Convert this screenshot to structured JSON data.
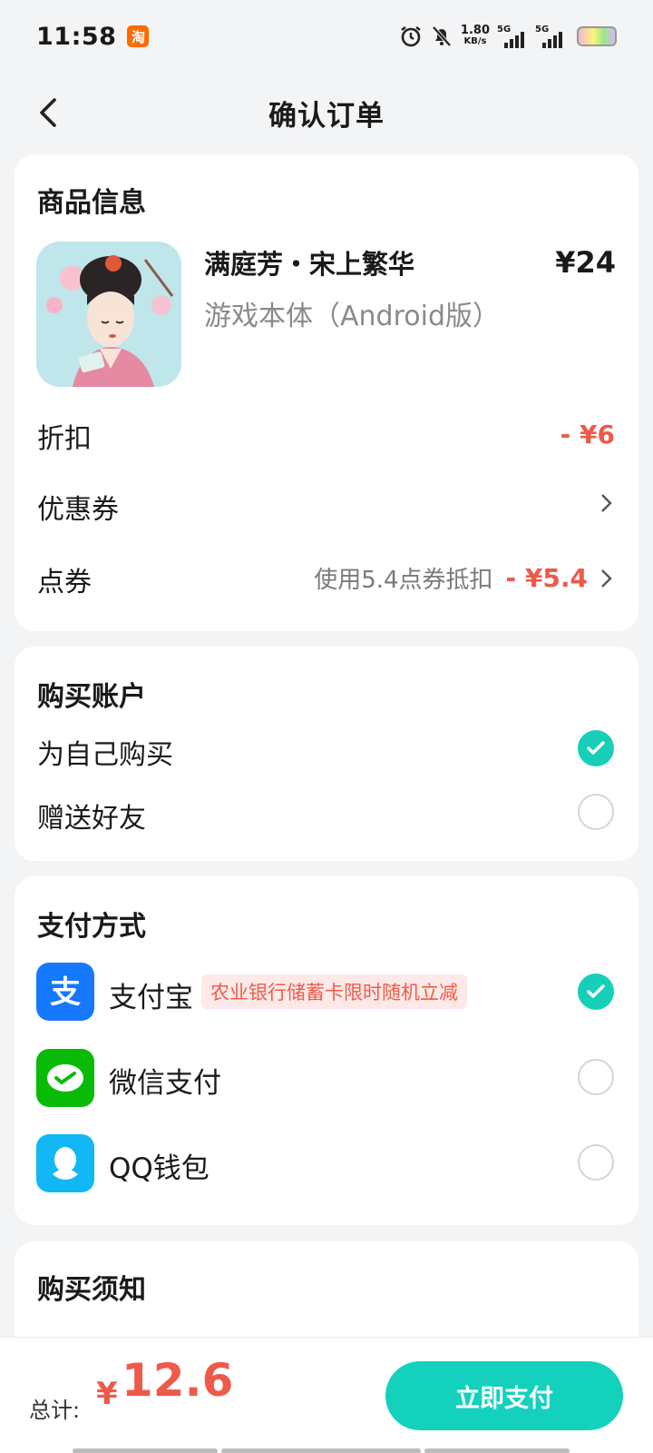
{
  "status_bar": {
    "time": "11:58",
    "app_badge": "淘",
    "speed_value": "1.80",
    "speed_unit": "KB/s",
    "sig1": "5G",
    "sig2": "5G"
  },
  "header": {
    "title": "确认订单"
  },
  "product": {
    "section_title": "商品信息",
    "name": "满庭芳・宋上繁华",
    "subtitle": "游戏本体（Android版）",
    "price": "¥24",
    "discount_label": "折扣",
    "discount_value": "- ¥6",
    "coupon_label": "优惠券",
    "points_label": "点券",
    "points_desc": "使用5.4点券抵扣",
    "points_value": "- ¥5.4"
  },
  "account": {
    "section_title": "购买账户",
    "options": [
      {
        "label": "为自己购买",
        "selected": true
      },
      {
        "label": "赠送好友",
        "selected": false
      }
    ]
  },
  "payment": {
    "section_title": "支付方式",
    "methods": [
      {
        "label": "支付宝",
        "promo": "农业银行储蓄卡限时随机立减",
        "selected": true,
        "icon": "alipay-icon",
        "color": "#1677ff"
      },
      {
        "label": "微信支付",
        "selected": false,
        "icon": "wechat-pay-icon",
        "color": "#09bb07"
      },
      {
        "label": "QQ钱包",
        "selected": false,
        "icon": "qq-wallet-icon",
        "color": "#12b7f5"
      }
    ]
  },
  "notice": {
    "section_title": "购买须知"
  },
  "footer": {
    "total_label": "总计:",
    "currency": "¥",
    "total_value": "12.6",
    "pay_button": "立即支付"
  },
  "colors": {
    "accent": "#14d1bd",
    "price_red": "#ee5a4a"
  }
}
